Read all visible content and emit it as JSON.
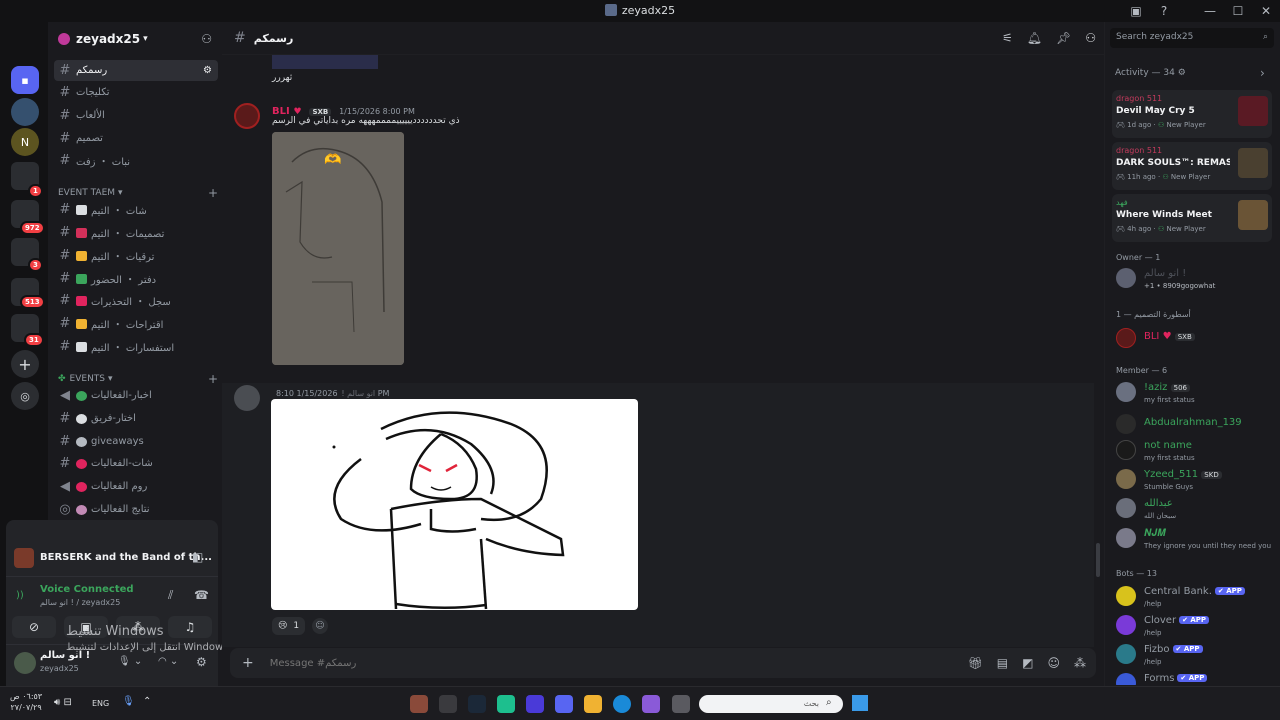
{
  "window": {
    "title": "zeyadx25"
  },
  "server": {
    "name": "zeyadx25"
  },
  "channels": {
    "top": [
      {
        "label": "رسمكم",
        "active": true
      },
      {
        "label": "تكليجات"
      },
      {
        "label": "الألعاب"
      },
      {
        "label": "تصميم"
      },
      {
        "label": "نبات ・ زفت"
      }
    ],
    "cat1": "EVENT TAEM",
    "team": [
      {
        "label": "شات ・ التيم"
      },
      {
        "label": "تصميمات ・ التيم"
      },
      {
        "label": "ترقيات ・ التيم"
      },
      {
        "label": "دفتر ・ الحضور"
      },
      {
        "label": "سجل ・ التحذيرات"
      },
      {
        "label": "اقتراحات ・ التيم"
      },
      {
        "label": "استفسارات ・ التيم"
      }
    ],
    "cat2": "EVENTS",
    "events": [
      {
        "label": "اخبار-الفعاليات"
      },
      {
        "label": "اختار-فريق"
      },
      {
        "label": "giveaways"
      },
      {
        "label": "شات-الفعاليات"
      },
      {
        "label": "روم الفعاليات"
      },
      {
        "label": "نتايج الفعاليات"
      }
    ]
  },
  "voice": {
    "activity": "BERSERK and the Band of th...",
    "status": "Voice Connected",
    "channel": "انو سالم ! / zeyadx25",
    "user_name": "انو سالم !",
    "user_tag": "zeyadx25"
  },
  "watermark": {
    "line1": "تنشيط Windows",
    "line2": "انتقل إلى الإعدادات لتنشيط Windows."
  },
  "header": {
    "channel": "رسمكم"
  },
  "messages": [
    {
      "text": "ثهررر"
    },
    {
      "user": "BLI",
      "tag": "SXB",
      "time": "1/15/2026 8:00 PM",
      "text": "ذي تحددددددييييييممممهههه مره بداياتي في الرسم"
    },
    {
      "user": "انو سالم !",
      "time": "1/15/2026 8:10 PM",
      "reactions": [
        {
          "emoji": "😢",
          "count": "1"
        }
      ]
    }
  ],
  "composer": {
    "placeholder": "Message #رسمكم"
  },
  "search": {
    "placeholder": "Search zeyadx25"
  },
  "activity": {
    "title": "Activity — 34",
    "cards": [
      {
        "who": "dragon 511",
        "game": "Devil May Cry 5",
        "meta": "1d ago",
        "tag": "New Player"
      },
      {
        "who": "dragon 511",
        "game": "DARK SOULS™: REMASTE...",
        "meta": "11h ago",
        "tag": "New Player"
      },
      {
        "who": "فهد",
        "game": "Where Winds Meet",
        "meta": "4h ago",
        "tag": "New Player"
      }
    ]
  },
  "groups": {
    "owner": "Owner — 1",
    "legend": "أسطورة التصميم — 1",
    "member": "Member — 6",
    "bots": "Bots — 13"
  },
  "members": {
    "owner": {
      "name": "انو سالم !",
      "status": "+1 • 8909gogowhat"
    },
    "legend": {
      "name": "BLI",
      "tag": "SXB"
    },
    "list": [
      {
        "name": "!aziz",
        "tag": "506",
        "status": "my first status",
        "color": "#3ba55c"
      },
      {
        "name": "Abdualrahman_139",
        "status": "",
        "color": "#3ba55c"
      },
      {
        "name": "not name",
        "status": "my first status",
        "color": "#3ba55c"
      },
      {
        "name": "Yzeed_511",
        "tag": "SKD",
        "status": "Stumble Guys",
        "color": "#3ba55c"
      },
      {
        "name": "عبدالله",
        "status": "سبحان الله",
        "color": "#3ba55c"
      },
      {
        "name": "𝑵𝑱𝑴",
        "status": "They ignore you until they need you",
        "color": "#3ba55c"
      }
    ],
    "bots": [
      {
        "name": "Central Bank.",
        "status": "/help"
      },
      {
        "name": "Clover",
        "status": "/help"
      },
      {
        "name": "Fizbo",
        "status": "/help"
      },
      {
        "name": "Forms",
        "status": ""
      }
    ]
  },
  "taskbar": {
    "time": "٠٦:٥٣ ص",
    "date": "٢٧/٠٧/٢٩",
    "lang": "ENG",
    "search": "بحث"
  },
  "badges": {
    "b1": "1",
    "b2": "972",
    "b3": "3",
    "b4": "513",
    "b5": "31"
  }
}
